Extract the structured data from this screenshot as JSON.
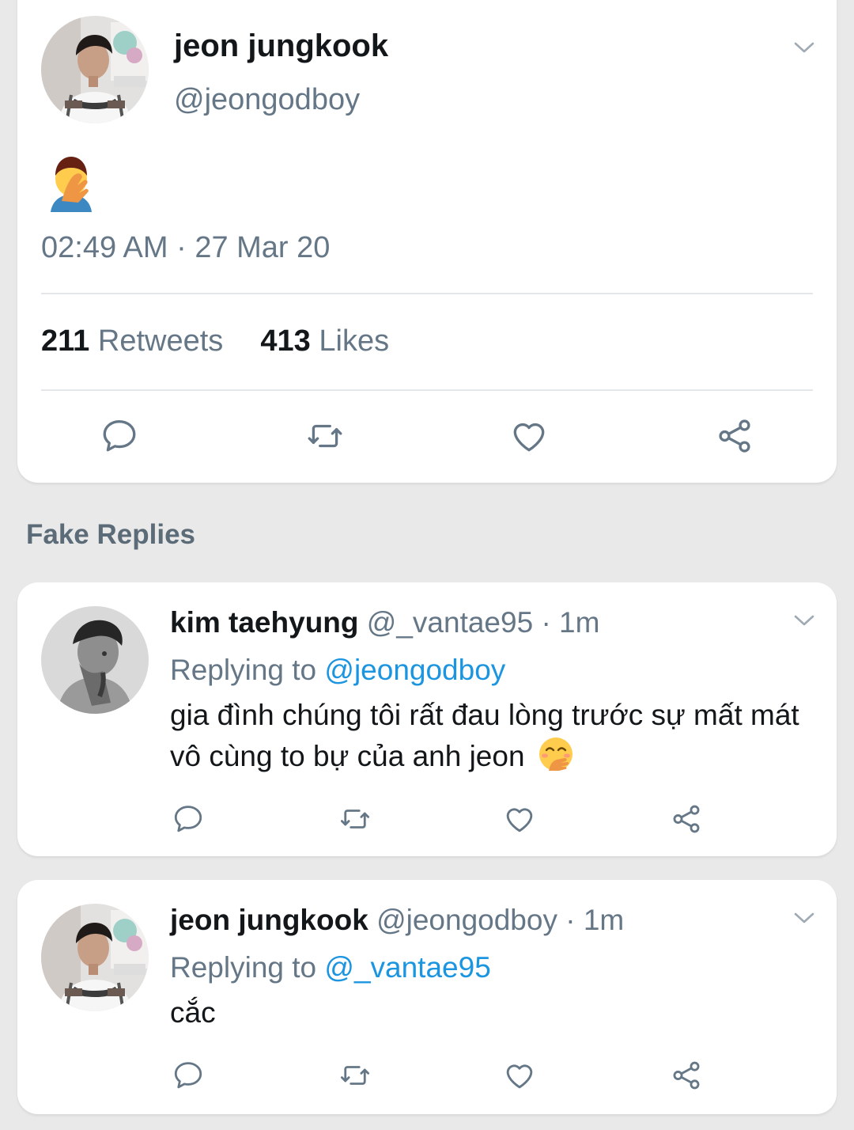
{
  "tweet": {
    "name": "jeon jungkook",
    "handle": "@jeongodboy",
    "body_emoji": "facepalm-emoji",
    "timestamp": "02:49 AM · 27 Mar 20",
    "retweets_count": "211",
    "retweets_label": "Retweets",
    "likes_count": "413",
    "likes_label": "Likes"
  },
  "section_title": "Fake Replies",
  "replies": [
    {
      "name": "kim taehyung",
      "handle": "@_vantae95",
      "time": "· 1m",
      "replying_prefix": "Replying to",
      "replying_to": "@jeongodboy",
      "text": "gia đình chúng tôi rất đau lòng trước sự mất mát vô cùng to bự của anh jeon",
      "trailing_emoji": "hand-over-mouth-emoji"
    },
    {
      "name": "jeon jungkook",
      "handle": "@jeongodboy",
      "time": "· 1m",
      "replying_prefix": "Replying to",
      "replying_to": "@_vantae95",
      "text": "cắc"
    }
  ],
  "icons": [
    "reply-icon",
    "retweet-icon",
    "like-icon",
    "share-icon",
    "chevron-down-icon"
  ],
  "colors": {
    "link": "#1b95e0",
    "secondary": "#657786",
    "icon": "#657786",
    "background": "#e9e9e9"
  }
}
